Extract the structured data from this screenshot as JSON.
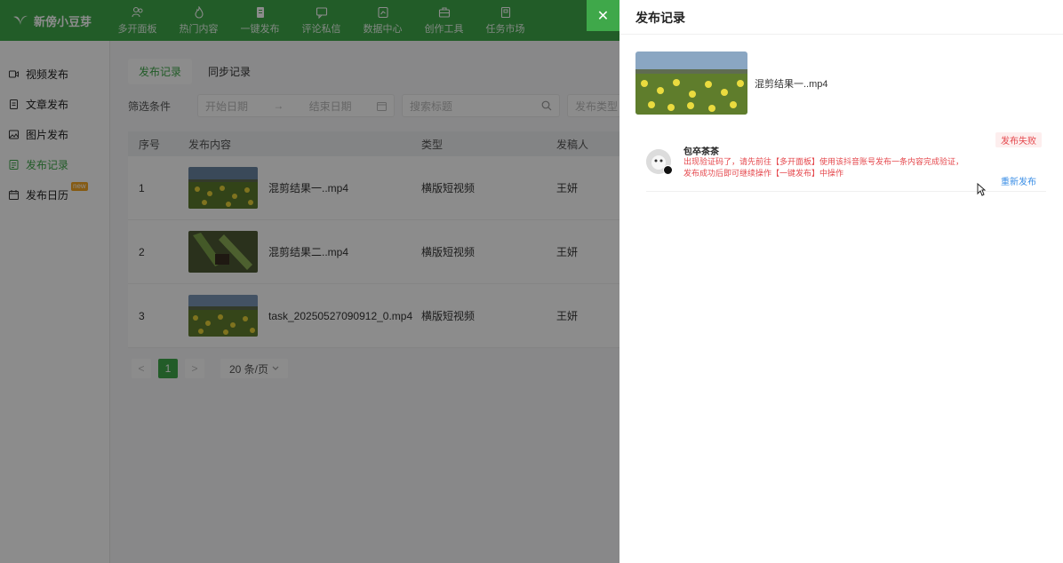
{
  "app": {
    "name": "新傍小豆芽"
  },
  "nav": [
    {
      "label": "多开面板",
      "icon": "users-icon"
    },
    {
      "label": "热门内容",
      "icon": "flame-icon"
    },
    {
      "label": "一键发布",
      "icon": "publish-icon"
    },
    {
      "label": "评论私信",
      "icon": "message-icon"
    },
    {
      "label": "数据中心",
      "icon": "chart-icon"
    },
    {
      "label": "创作工具",
      "icon": "toolbox-icon"
    },
    {
      "label": "任务市场",
      "icon": "task-icon"
    }
  ],
  "sidebar": [
    {
      "label": "视频发布",
      "icon": "video-icon"
    },
    {
      "label": "文章发布",
      "icon": "article-icon"
    },
    {
      "label": "图片发布",
      "icon": "image-icon"
    },
    {
      "label": "发布记录",
      "icon": "records-icon"
    },
    {
      "label": "发布日历",
      "icon": "calendar-icon",
      "badge": "new"
    }
  ],
  "main": {
    "tabs": [
      "发布记录",
      "同步记录"
    ],
    "filters": {
      "label": "筛选条件",
      "start_placeholder": "开始日期",
      "arrow": "→",
      "end_placeholder": "结束日期",
      "search_placeholder": "搜索标题",
      "type_placeholder": "发布类型"
    },
    "table": {
      "headers": [
        "序号",
        "发布内容",
        "类型",
        "发稿人"
      ],
      "rows": [
        {
          "no": "1",
          "title": "混剪结果一..mp4",
          "type": "横版短视频",
          "user": "王妍"
        },
        {
          "no": "2",
          "title": "混剪结果二..mp4",
          "type": "横版短视频",
          "user": "王妍"
        },
        {
          "no": "3",
          "title": "task_20250527090912_0.mp4",
          "type": "横版短视频",
          "user": "王妍"
        }
      ]
    },
    "pagination": {
      "prev": "<",
      "current": "1",
      "next": ">",
      "page_size": "20 条/页"
    }
  },
  "drawer": {
    "close": "✕",
    "title": "发布记录",
    "video_name": "混剪结果一..mp4",
    "record": {
      "account": "包卒茶茶",
      "error": "出现验证码了，请先前往【多开面板】使用该抖音账号发布一条内容完成验证，发布成功后即可继续操作【一键发布】中操作",
      "status": "发布失败",
      "action": "重新发布"
    }
  },
  "colors": {
    "brand": "#3fa84a",
    "error": "#e5484d",
    "link": "#3a8ee6"
  }
}
